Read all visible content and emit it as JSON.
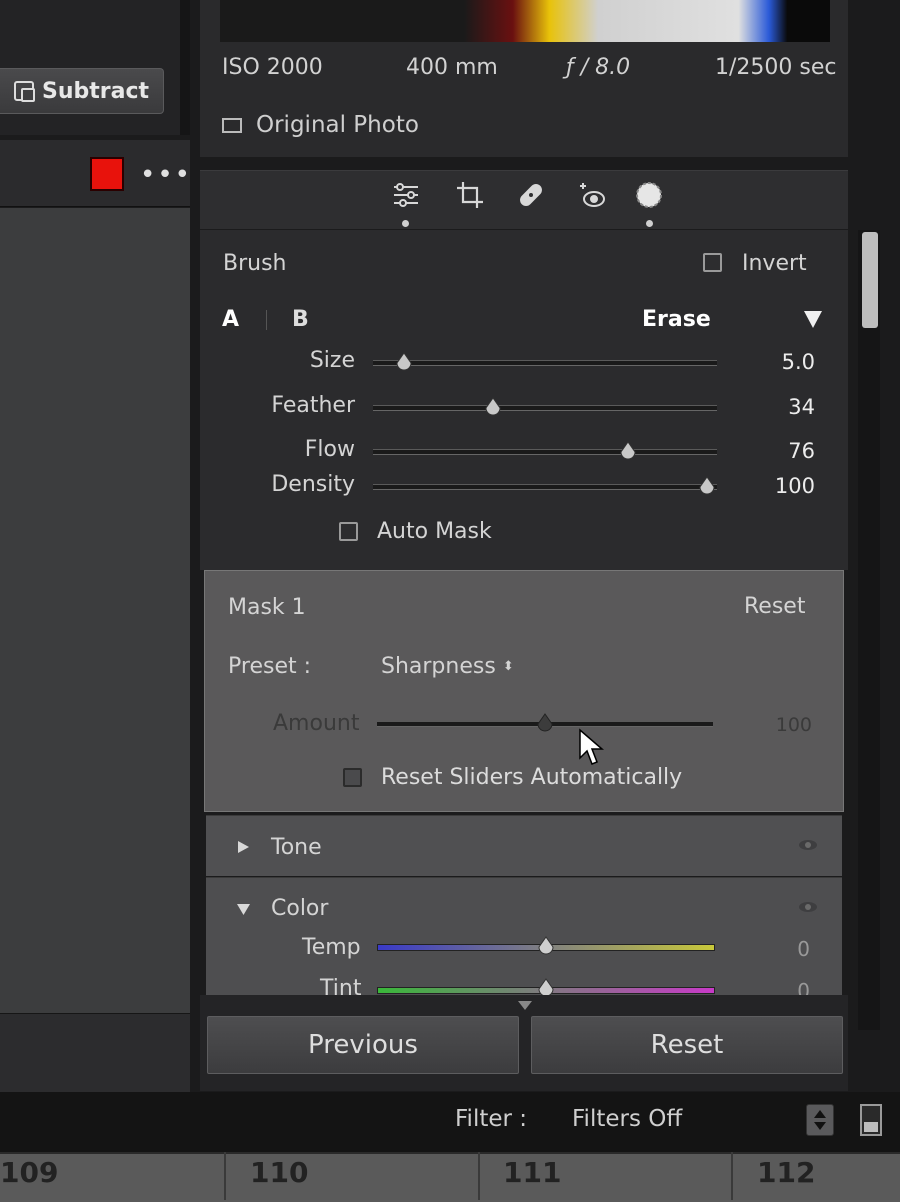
{
  "left": {
    "subtract_label": "Subtract",
    "more_label": "•••",
    "swatch_color": "#e8120c"
  },
  "exif": {
    "iso": "ISO 2000",
    "focal": "400 mm",
    "aperture": "ƒ / 8.0",
    "shutter": "1/2500 sec"
  },
  "original_photo_label": "Original Photo",
  "tools": [
    "sliders-icon",
    "crop-icon",
    "heal-icon",
    "redeye-icon",
    "mask-brush-icon"
  ],
  "brush": {
    "title": "Brush",
    "invert_label": "Invert",
    "tab_a": "A",
    "tab_b": "B",
    "erase_label": "Erase",
    "sliders": [
      {
        "label": "Size",
        "value": "5.0",
        "pos": 0.09
      },
      {
        "label": "Feather",
        "value": "34",
        "pos": 0.35
      },
      {
        "label": "Flow",
        "value": "76",
        "pos": 0.74
      },
      {
        "label": "Density",
        "value": "100",
        "pos": 0.97
      }
    ],
    "auto_mask_label": "Auto Mask"
  },
  "mask": {
    "title": "Mask 1",
    "reset_label": "Reset",
    "preset_label": "Preset :",
    "preset_value": "Sharpness",
    "amount_label": "Amount",
    "amount_value": "100",
    "amount_pos": 0.5,
    "reset_sliders_label": "Reset Sliders Automatically"
  },
  "sections": {
    "tone_label": "Tone",
    "color_label": "Color",
    "temp_label": "Temp",
    "temp_value": "0",
    "tint_label": "Tint",
    "tint_value": "0"
  },
  "buttons": {
    "previous_label": "Previous",
    "reset_label": "Reset"
  },
  "filter": {
    "label": "Filter :",
    "value": "Filters Off"
  },
  "filmstrip": [
    "109",
    "110",
    "111",
    "112"
  ]
}
